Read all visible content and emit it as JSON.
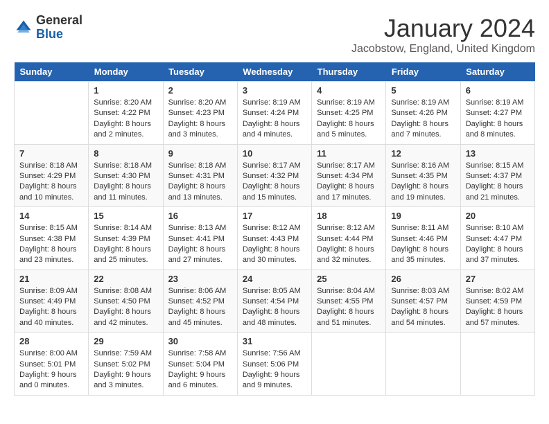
{
  "header": {
    "logo_general": "General",
    "logo_blue": "Blue",
    "month_title": "January 2024",
    "location": "Jacobstow, England, United Kingdom"
  },
  "days_of_week": [
    "Sunday",
    "Monday",
    "Tuesday",
    "Wednesday",
    "Thursday",
    "Friday",
    "Saturday"
  ],
  "weeks": [
    [
      {
        "day": "",
        "info": ""
      },
      {
        "day": "1",
        "info": "Sunrise: 8:20 AM\nSunset: 4:22 PM\nDaylight: 8 hours\nand 2 minutes."
      },
      {
        "day": "2",
        "info": "Sunrise: 8:20 AM\nSunset: 4:23 PM\nDaylight: 8 hours\nand 3 minutes."
      },
      {
        "day": "3",
        "info": "Sunrise: 8:19 AM\nSunset: 4:24 PM\nDaylight: 8 hours\nand 4 minutes."
      },
      {
        "day": "4",
        "info": "Sunrise: 8:19 AM\nSunset: 4:25 PM\nDaylight: 8 hours\nand 5 minutes."
      },
      {
        "day": "5",
        "info": "Sunrise: 8:19 AM\nSunset: 4:26 PM\nDaylight: 8 hours\nand 7 minutes."
      },
      {
        "day": "6",
        "info": "Sunrise: 8:19 AM\nSunset: 4:27 PM\nDaylight: 8 hours\nand 8 minutes."
      }
    ],
    [
      {
        "day": "7",
        "info": "Sunrise: 8:18 AM\nSunset: 4:29 PM\nDaylight: 8 hours\nand 10 minutes."
      },
      {
        "day": "8",
        "info": "Sunrise: 8:18 AM\nSunset: 4:30 PM\nDaylight: 8 hours\nand 11 minutes."
      },
      {
        "day": "9",
        "info": "Sunrise: 8:18 AM\nSunset: 4:31 PM\nDaylight: 8 hours\nand 13 minutes."
      },
      {
        "day": "10",
        "info": "Sunrise: 8:17 AM\nSunset: 4:32 PM\nDaylight: 8 hours\nand 15 minutes."
      },
      {
        "day": "11",
        "info": "Sunrise: 8:17 AM\nSunset: 4:34 PM\nDaylight: 8 hours\nand 17 minutes."
      },
      {
        "day": "12",
        "info": "Sunrise: 8:16 AM\nSunset: 4:35 PM\nDaylight: 8 hours\nand 19 minutes."
      },
      {
        "day": "13",
        "info": "Sunrise: 8:15 AM\nSunset: 4:37 PM\nDaylight: 8 hours\nand 21 minutes."
      }
    ],
    [
      {
        "day": "14",
        "info": "Sunrise: 8:15 AM\nSunset: 4:38 PM\nDaylight: 8 hours\nand 23 minutes."
      },
      {
        "day": "15",
        "info": "Sunrise: 8:14 AM\nSunset: 4:39 PM\nDaylight: 8 hours\nand 25 minutes."
      },
      {
        "day": "16",
        "info": "Sunrise: 8:13 AM\nSunset: 4:41 PM\nDaylight: 8 hours\nand 27 minutes."
      },
      {
        "day": "17",
        "info": "Sunrise: 8:12 AM\nSunset: 4:43 PM\nDaylight: 8 hours\nand 30 minutes."
      },
      {
        "day": "18",
        "info": "Sunrise: 8:12 AM\nSunset: 4:44 PM\nDaylight: 8 hours\nand 32 minutes."
      },
      {
        "day": "19",
        "info": "Sunrise: 8:11 AM\nSunset: 4:46 PM\nDaylight: 8 hours\nand 35 minutes."
      },
      {
        "day": "20",
        "info": "Sunrise: 8:10 AM\nSunset: 4:47 PM\nDaylight: 8 hours\nand 37 minutes."
      }
    ],
    [
      {
        "day": "21",
        "info": "Sunrise: 8:09 AM\nSunset: 4:49 PM\nDaylight: 8 hours\nand 40 minutes."
      },
      {
        "day": "22",
        "info": "Sunrise: 8:08 AM\nSunset: 4:50 PM\nDaylight: 8 hours\nand 42 minutes."
      },
      {
        "day": "23",
        "info": "Sunrise: 8:06 AM\nSunset: 4:52 PM\nDaylight: 8 hours\nand 45 minutes."
      },
      {
        "day": "24",
        "info": "Sunrise: 8:05 AM\nSunset: 4:54 PM\nDaylight: 8 hours\nand 48 minutes."
      },
      {
        "day": "25",
        "info": "Sunrise: 8:04 AM\nSunset: 4:55 PM\nDaylight: 8 hours\nand 51 minutes."
      },
      {
        "day": "26",
        "info": "Sunrise: 8:03 AM\nSunset: 4:57 PM\nDaylight: 8 hours\nand 54 minutes."
      },
      {
        "day": "27",
        "info": "Sunrise: 8:02 AM\nSunset: 4:59 PM\nDaylight: 8 hours\nand 57 minutes."
      }
    ],
    [
      {
        "day": "28",
        "info": "Sunrise: 8:00 AM\nSunset: 5:01 PM\nDaylight: 9 hours\nand 0 minutes."
      },
      {
        "day": "29",
        "info": "Sunrise: 7:59 AM\nSunset: 5:02 PM\nDaylight: 9 hours\nand 3 minutes."
      },
      {
        "day": "30",
        "info": "Sunrise: 7:58 AM\nSunset: 5:04 PM\nDaylight: 9 hours\nand 6 minutes."
      },
      {
        "day": "31",
        "info": "Sunrise: 7:56 AM\nSunset: 5:06 PM\nDaylight: 9 hours\nand 9 minutes."
      },
      {
        "day": "",
        "info": ""
      },
      {
        "day": "",
        "info": ""
      },
      {
        "day": "",
        "info": ""
      }
    ]
  ]
}
